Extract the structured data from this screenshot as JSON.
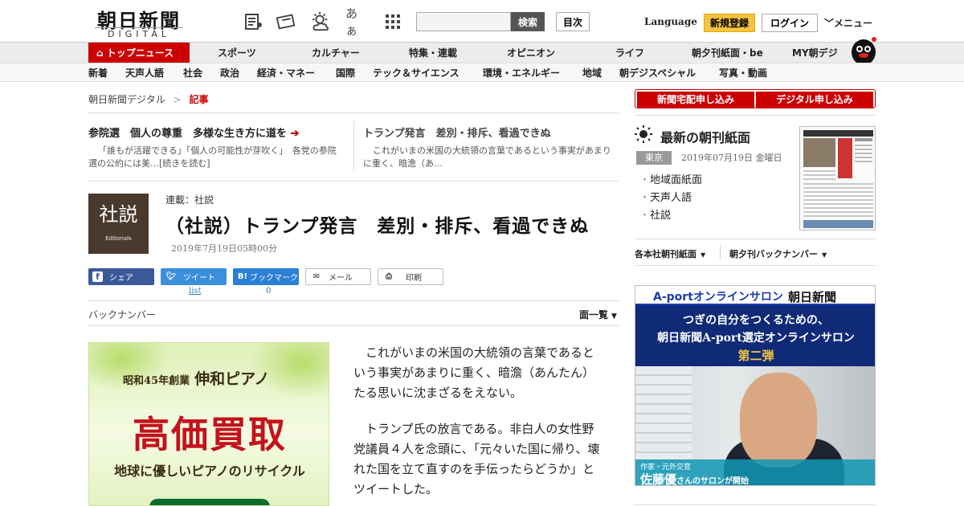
{
  "header": {
    "logo": "朝日新聞",
    "logo_sub": "DIGITAL",
    "kana_toggle": "あぁ",
    "search_button": "検索",
    "toc_button": "目次",
    "language": "Language",
    "register": "新規登録",
    "login": "ログイン",
    "menu": "メニュー",
    "search_placeholder": ""
  },
  "nav_primary": [
    "トップニュース",
    "スポーツ",
    "カルチャー",
    "特集・連載",
    "オピニオン",
    "ライフ",
    "朝夕刊紙面・be",
    "MY朝デジ"
  ],
  "nav_secondary": [
    "新着",
    "天声人語",
    "社会",
    "政治",
    "経済・マネー",
    "国際",
    "テック＆サイエンス",
    "環境・エネルギー",
    "地域",
    "朝デジスペシャル",
    "写真・動画"
  ],
  "breadcrumb": {
    "home": "朝日新聞デジタル",
    "sep": ">",
    "current": "記事"
  },
  "related": [
    {
      "title": "参院選　個人の尊重　多様な生き方に道を",
      "body": "「誰もが活躍できる」「個人の可能性が芽吹く」　各党の参院選の公約には美…[続きを読む]"
    },
    {
      "title": "トランプ発言　差別・排斥、看過できぬ",
      "body": "これがいまの米国の大統領の言葉であるという事実があまりに重く、暗澹（あ…"
    }
  ],
  "article": {
    "series": "連載：社説",
    "headline": "（社説）トランプ発言　差別・排斥、看過できぬ",
    "date": "2019年7月19日05時00分",
    "editorial_label": "社説",
    "editorial_sub": "Editorials",
    "paragraphs": [
      "これがいまの米国の大統領の言葉であるという事実があまりに重く、暗澹（あんたん）たる思いに沈まざるをえない。",
      "トランプ氏の放言である。非白人の女性野党議員４人を念頭に、「元々いた国に帰り、壊れた国を立て直すのを手伝ったらどうか」とツイートした。"
    ]
  },
  "share": {
    "facebook": "シェア",
    "twitter": "ツイート",
    "hatena": "ブックマーク",
    "mail": "メール",
    "print": "印刷",
    "twitter_count": "list",
    "hatena_count": "0"
  },
  "backnumber": {
    "label": "バックナンバー",
    "list": "面一覧"
  },
  "ad_left": {
    "line1": "昭和45年創業",
    "brand": "伸和ピアノ",
    "headline": "高価買取",
    "tagline": "地球に優しいピアノのリサイクル"
  },
  "sidebar": {
    "btn_home_delivery": "新聞宅配申し込み",
    "btn_digital": "デジタル申し込み",
    "paper_title": "最新の朝刊紙面",
    "region": "東京",
    "paper_date": "2019年07月19日 金曜日",
    "links": [
      "地域面紙面",
      "天声人語",
      "社説"
    ],
    "select1": "各本社朝刊紙面",
    "select2": "朝夕刊バックナンバー"
  },
  "ad_right": {
    "aport": "A-portオンラインサロン",
    "asahi": "朝日新聞",
    "line1": "つぎの自分をつくるための、",
    "line2": "朝日新聞A-port選定オンラインサロン",
    "line3": "第二弾",
    "role": "作家・元外交官",
    "name": "佐藤優",
    "suffix": "さんのサロンが開始"
  },
  "colors": {
    "brand_red": "#cc0000",
    "register_yellow": "#f5c343",
    "twitter": "#3b8fdc",
    "facebook": "#3b5998",
    "hatena": "#2b7fd6"
  }
}
